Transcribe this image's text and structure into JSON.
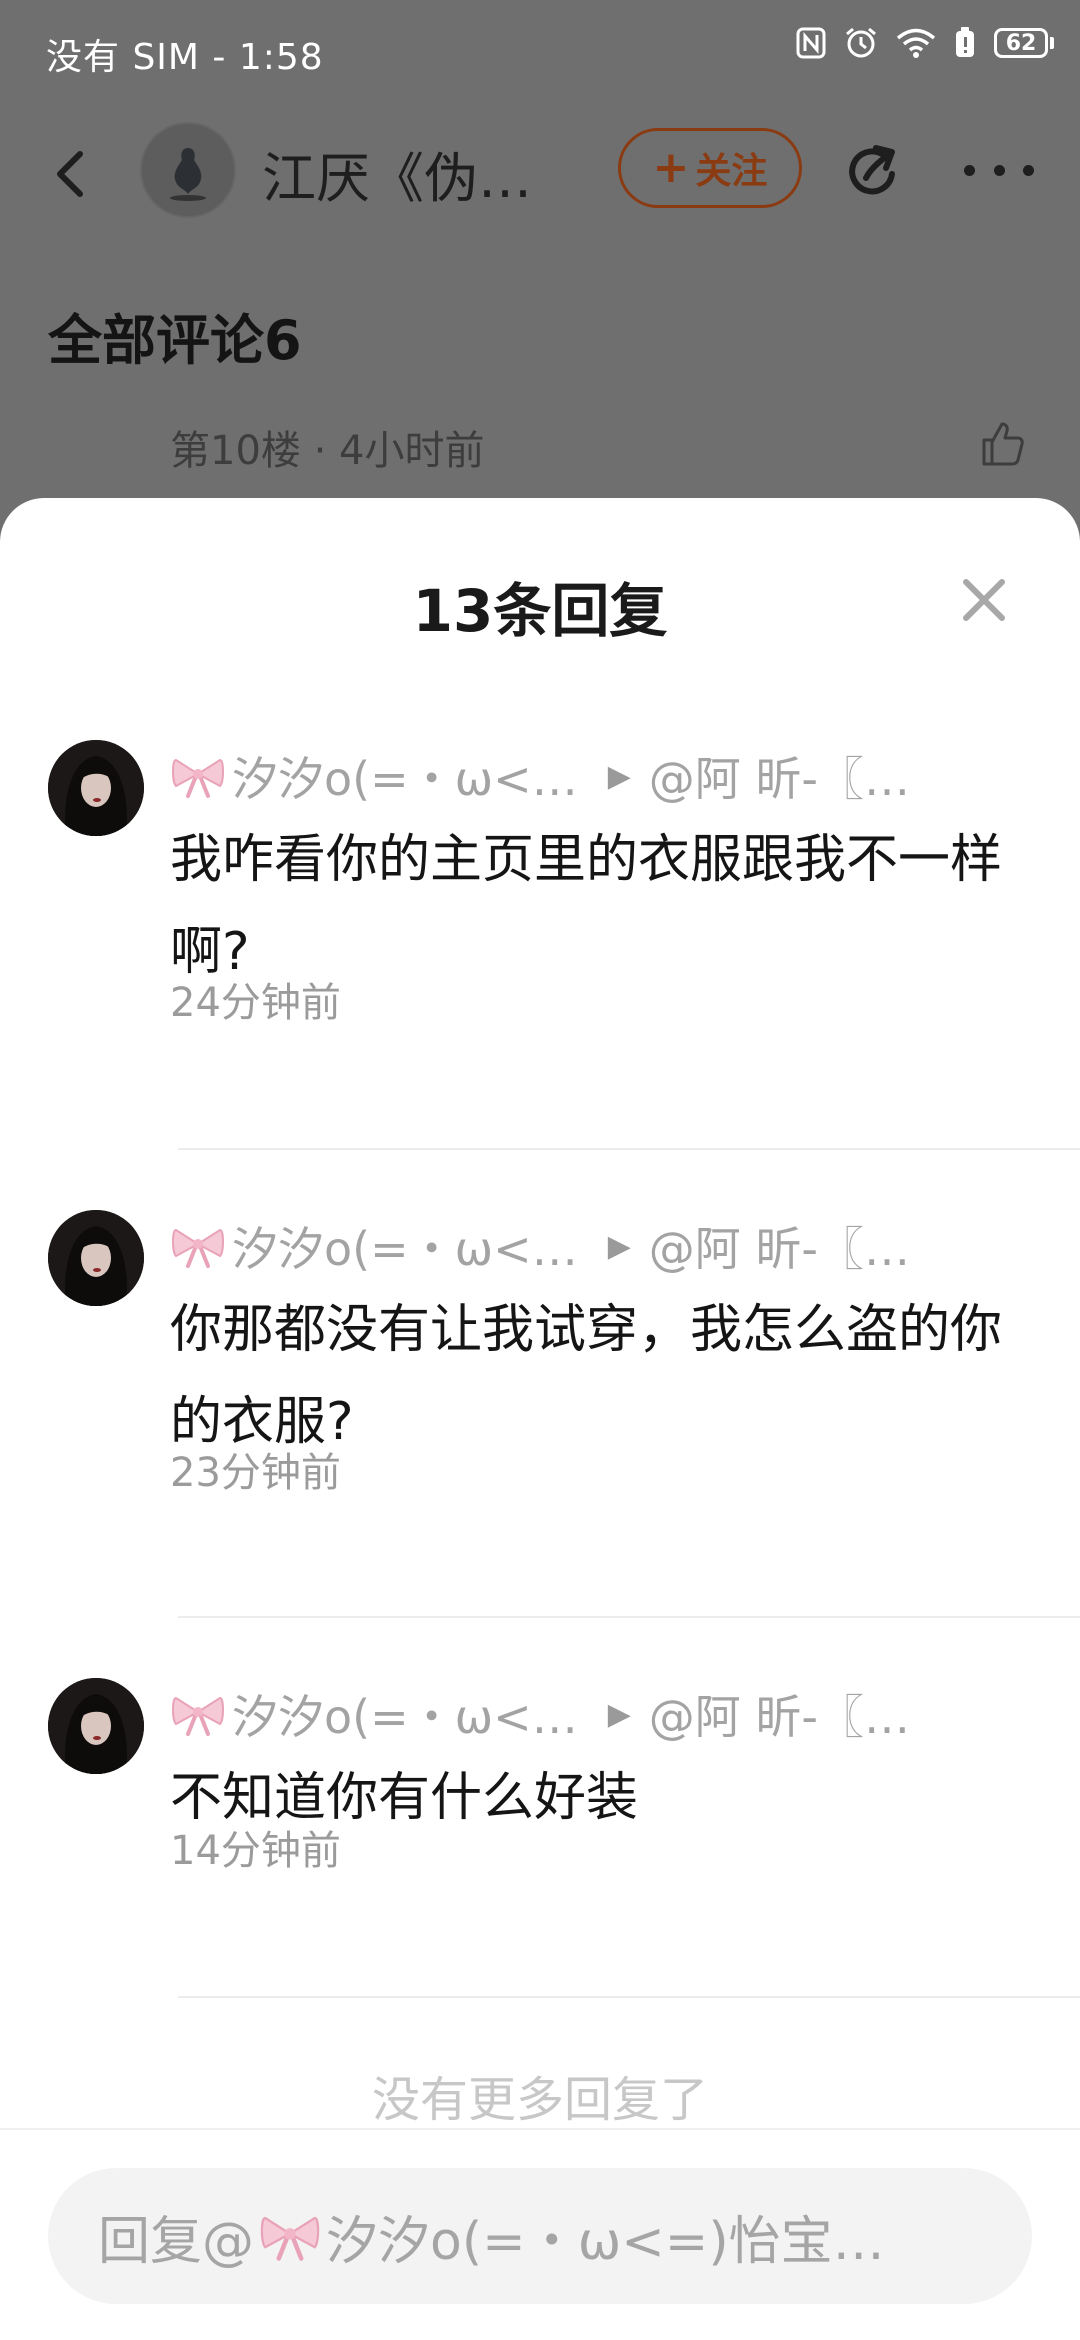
{
  "status_bar": {
    "text": "没有 SIM - 1:58",
    "battery": "62",
    "icons": [
      "nfc-icon",
      "alarm-icon",
      "wifi-icon",
      "battery-saver-icon",
      "battery-icon"
    ]
  },
  "header": {
    "author_name": "江厌《伪…",
    "follow_label": "关注",
    "follow_color": "#8a3b12"
  },
  "background_page": {
    "section_title": "全部评论6",
    "floor_meta": "第10楼 · 4小时前"
  },
  "sheet": {
    "title": "13条回复",
    "replies": [
      {
        "user": "汐汐o(=・ω<…",
        "target": "@阿 昕-〖…",
        "text": "我咋看你的主页里的衣服跟我不一样啊?",
        "time": "24分钟前"
      },
      {
        "user": "汐汐o(=・ω<…",
        "target": "@阿 昕-〖…",
        "text": "你那都没有让我试穿，我怎么盗的你的衣服?",
        "time": "23分钟前"
      },
      {
        "user": "汐汐o(=・ω<…",
        "target": "@阿 昕-〖…",
        "text": "不知道你有什么好装",
        "time": "14分钟前"
      }
    ],
    "no_more": "没有更多回复了",
    "input_prefix": "回复@",
    "input_user": "汐汐o(=・ω<=)怡宝…"
  }
}
